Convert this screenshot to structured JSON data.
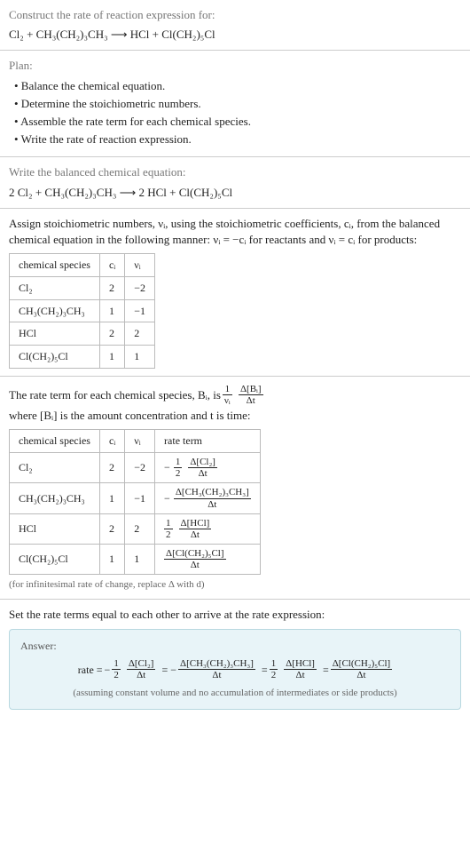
{
  "prompt": {
    "title": "Construct the rate of reaction expression for:",
    "equation": "Cl₂ + CH₃(CH₂)₃CH₃  ⟶  HCl + Cl(CH₂)₅Cl"
  },
  "plan": {
    "title": "Plan:",
    "items": [
      "• Balance the chemical equation.",
      "• Determine the stoichiometric numbers.",
      "• Assemble the rate term for each chemical species.",
      "• Write the rate of reaction expression."
    ]
  },
  "balanced": {
    "title": "Write the balanced chemical equation:",
    "equation": "2 Cl₂ + CH₃(CH₂)₃CH₃  ⟶  2 HCl + Cl(CH₂)₅Cl"
  },
  "stoich": {
    "intro_a": "Assign stoichiometric numbers, νᵢ, using the stoichiometric coefficients, cᵢ, from the balanced chemical equation in the following manner: νᵢ = −cᵢ for reactants and νᵢ = cᵢ for products:",
    "headers": [
      "chemical species",
      "cᵢ",
      "νᵢ"
    ],
    "rows": [
      {
        "species": "Cl₂",
        "c": "2",
        "v": "−2"
      },
      {
        "species": "CH₃(CH₂)₃CH₃",
        "c": "1",
        "v": "−1"
      },
      {
        "species": "HCl",
        "c": "2",
        "v": "2"
      },
      {
        "species": "Cl(CH₂)₅Cl",
        "c": "1",
        "v": "1"
      }
    ]
  },
  "rate_terms": {
    "intro_a": "The rate term for each chemical species, Bᵢ, is ",
    "intro_b": " where [Bᵢ] is the amount concentration and t is time:",
    "frac1_num": "1",
    "frac1_den": "νᵢ",
    "frac2_num": "Δ[Bᵢ]",
    "frac2_den": "Δt",
    "headers": [
      "chemical species",
      "cᵢ",
      "νᵢ",
      "rate term"
    ],
    "rows": [
      {
        "species": "Cl₂",
        "c": "2",
        "v": "−2",
        "term_prefix": "−",
        "term_num1": "1",
        "term_den1": "2",
        "term_num2": "Δ[Cl₂]",
        "term_den2": "Δt"
      },
      {
        "species": "CH₃(CH₂)₃CH₃",
        "c": "1",
        "v": "−1",
        "term_prefix": "−",
        "term_num1": "",
        "term_den1": "",
        "term_num2": "Δ[CH₃(CH₂)₃CH₃]",
        "term_den2": "Δt"
      },
      {
        "species": "HCl",
        "c": "2",
        "v": "2",
        "term_prefix": "",
        "term_num1": "1",
        "term_den1": "2",
        "term_num2": "Δ[HCl]",
        "term_den2": "Δt"
      },
      {
        "species": "Cl(CH₂)₅Cl",
        "c": "1",
        "v": "1",
        "term_prefix": "",
        "term_num1": "",
        "term_den1": "",
        "term_num2": "Δ[Cl(CH₂)₅Cl]",
        "term_den2": "Δt"
      }
    ],
    "footnote": "(for infinitesimal rate of change, replace Δ with d)"
  },
  "final": {
    "title": "Set the rate terms equal to each other to arrive at the rate expression:"
  },
  "answer": {
    "label": "Answer:",
    "prefix": "rate = ",
    "terms": [
      {
        "pre": "−",
        "n1": "1",
        "d1": "2",
        "n2": "Δ[Cl₂]",
        "d2": "Δt"
      },
      {
        "pre": "= −",
        "n1": "",
        "d1": "",
        "n2": "Δ[CH₃(CH₂)₃CH₃]",
        "d2": "Δt"
      },
      {
        "pre": "= ",
        "n1": "1",
        "d1": "2",
        "n2": "Δ[HCl]",
        "d2": "Δt"
      },
      {
        "pre": "= ",
        "n1": "",
        "d1": "",
        "n2": "Δ[Cl(CH₂)₅Cl]",
        "d2": "Δt"
      }
    ],
    "note": "(assuming constant volume and no accumulation of intermediates or side products)"
  }
}
